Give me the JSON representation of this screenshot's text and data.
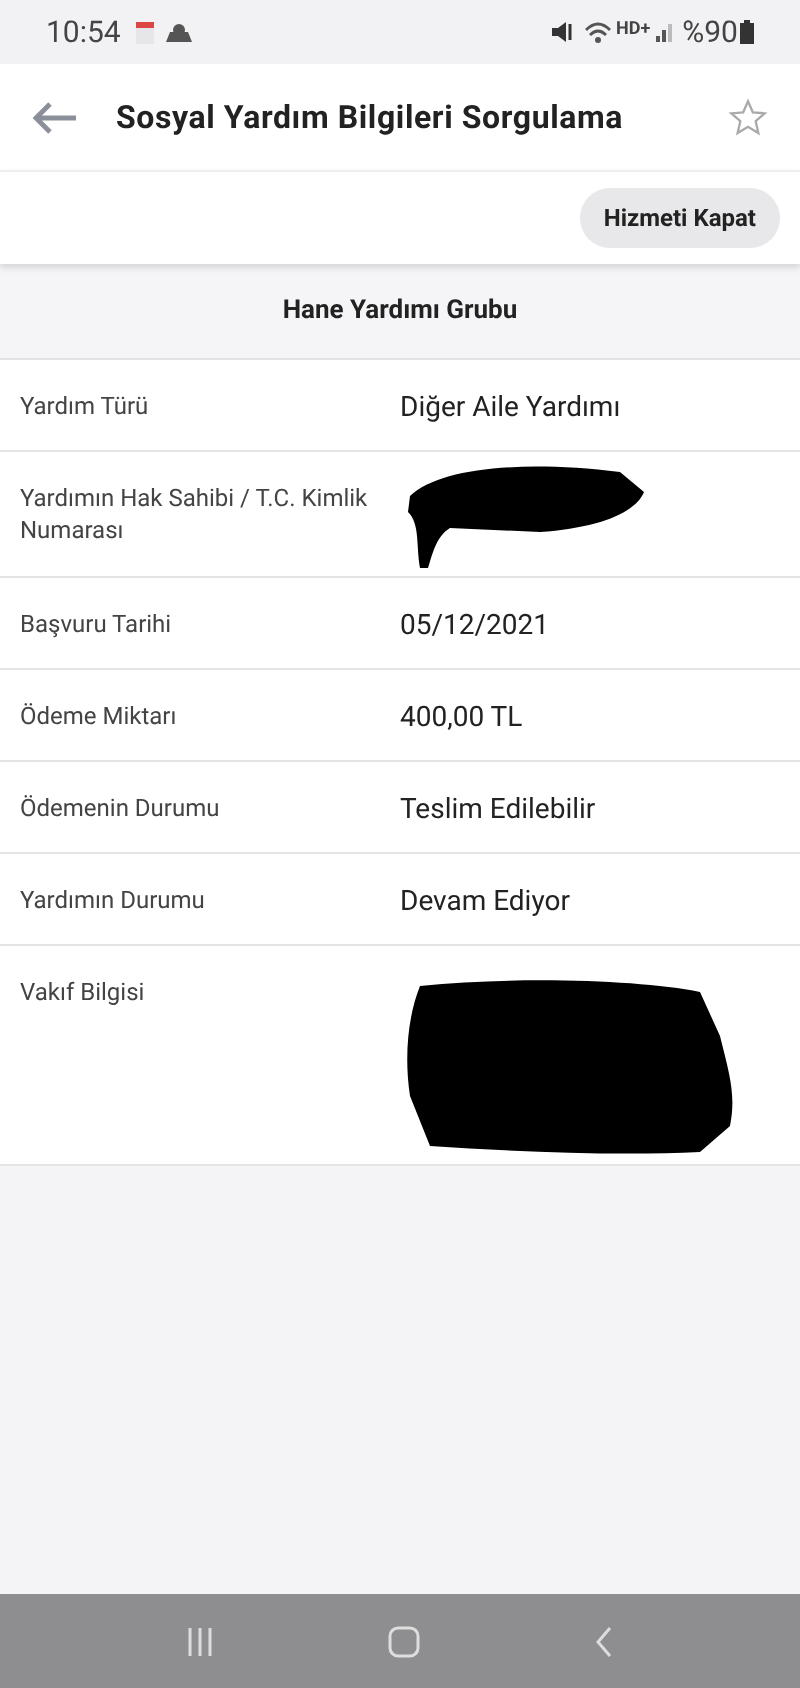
{
  "status_bar": {
    "time": "10:54",
    "hd": "HD+",
    "battery": "%90"
  },
  "header": {
    "title": "Sosyal Yardım Bilgileri Sorgulama"
  },
  "close_button": "Hizmeti Kapat",
  "group": {
    "title": "Hane Yardımı Grubu",
    "rows": [
      {
        "label": "Yardım Türü",
        "kind": "text",
        "value": "Diğer Aile Yardımı"
      },
      {
        "label": "Yardımın Hak Sahibi / T.C. Kimlik Numarası",
        "kind": "redacted"
      },
      {
        "label": "Başvuru Tarihi",
        "kind": "text",
        "value": "05/12/2021"
      },
      {
        "label": "Ödeme Miktarı",
        "kind": "text",
        "value": "400,00 TL"
      },
      {
        "label": "Ödemenin Durumu",
        "kind": "text",
        "value": "Teslim Edilebilir"
      },
      {
        "label": "Yardımın Durumu",
        "kind": "text",
        "value": "Devam Ediyor"
      },
      {
        "label": "Vakıf Bilgisi",
        "kind": "redacted_large"
      }
    ]
  }
}
